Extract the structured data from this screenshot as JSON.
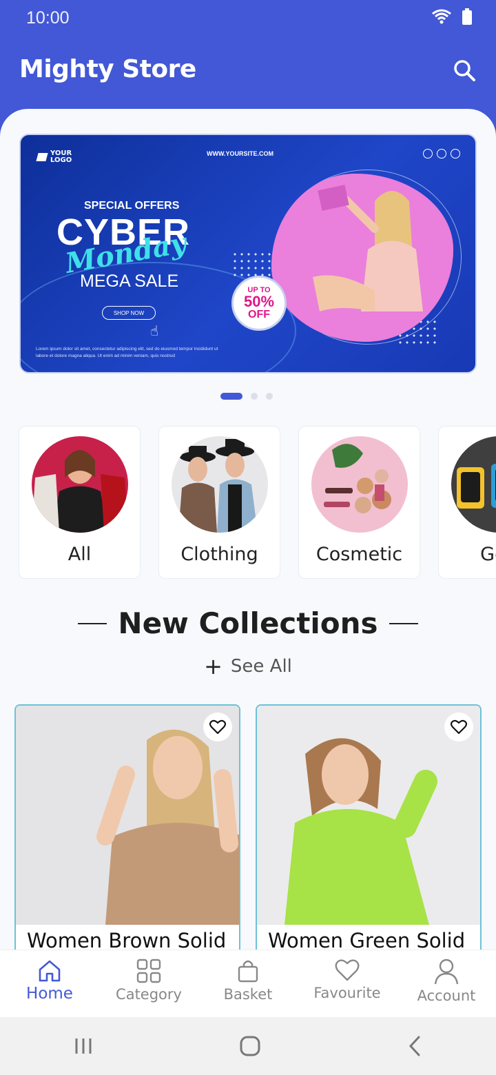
{
  "status": {
    "time": "10:00"
  },
  "header": {
    "title": "Mighty Store"
  },
  "banner": {
    "logo": "YOUR\nLOGO",
    "site": "WWW.YOURSITE.COM",
    "special": "SPECIAL OFFERS",
    "cyber": "CYBER",
    "monday": "Monday",
    "mega": "MEGA SALE",
    "shop": "SHOP NOW",
    "badge_top": "UP TO",
    "badge_pct": "50%",
    "badge_off": "OFF",
    "lorem": "Lorem ipsum dolor sit amet, consectetur adipiscing elit, sed do eiusmod tempor incididunt ut labore et dolore magna aliqua. Ut enim ad minim veniam, quis nostrud",
    "pages": 3,
    "active_page": 1
  },
  "categories": [
    {
      "label": "All"
    },
    {
      "label": "Clothing"
    },
    {
      "label": "Cosmetic"
    },
    {
      "label": "Gen"
    }
  ],
  "collections": {
    "title": "New Collections",
    "see_all": "See All",
    "products": [
      {
        "name": "Women Brown Solid"
      },
      {
        "name": "Women Green Solid"
      }
    ]
  },
  "bottom_nav": [
    {
      "label": "Home",
      "icon": "home-icon",
      "active": true
    },
    {
      "label": "Category",
      "icon": "grid-icon",
      "active": false
    },
    {
      "label": "Basket",
      "icon": "bag-icon",
      "active": false
    },
    {
      "label": "Favourite",
      "icon": "heart-icon",
      "active": false
    },
    {
      "label": "Account",
      "icon": "user-icon",
      "active": false
    }
  ],
  "colors": {
    "primary": "#4358d6",
    "card_border": "#6bc2d7"
  }
}
